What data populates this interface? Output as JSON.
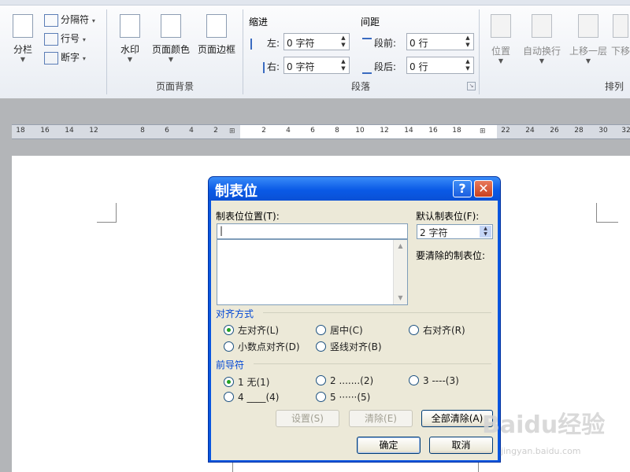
{
  "ribbon": {
    "columns_label": "分栏",
    "breaks_label": "分隔符",
    "line_numbers_label": "行号",
    "hyphenation_label": "断字",
    "watermark_label": "水印",
    "page_color_label": "页面颜色",
    "page_borders_label": "页面边框",
    "page_background_group": "页面背景",
    "indent_header": "缩进",
    "indent_left_label": "左:",
    "indent_left_value": "0 字符",
    "indent_right_label": "右:",
    "indent_right_value": "0 字符",
    "spacing_header": "间距",
    "spacing_before_label": "段前:",
    "spacing_before_value": "0 行",
    "spacing_after_label": "段后:",
    "spacing_after_value": "0 行",
    "paragraph_group": "段落",
    "position_label": "位置",
    "wrap_text_label": "自动换行",
    "bring_forward_label": "上移一层",
    "send_backward_label": "下移",
    "arrange_group": "排列"
  },
  "ruler": {
    "left_numbers": [
      "18",
      "16",
      "14",
      "12",
      "8",
      "6",
      "4",
      "2"
    ],
    "right_numbers": [
      "2",
      "4",
      "6",
      "8",
      "10",
      "12",
      "14",
      "16",
      "18",
      "20",
      "22",
      "24",
      "26",
      "28",
      "30",
      "32"
    ]
  },
  "dialog": {
    "title": "制表位",
    "help_symbol": "?",
    "close_symbol": "✕",
    "tab_stop_position_label": "制表位位置(T):",
    "tab_stop_position_value": "|",
    "default_tab_stops_label": "默认制表位(F):",
    "default_tab_stops_value": "2 字符",
    "tab_stops_to_clear_label": "要清除的制表位:",
    "alignment_title": "对齐方式",
    "alignment_options": [
      "左对齐(L)",
      "居中(C)",
      "右对齐(R)",
      "小数点对齐(D)",
      "竖线对齐(B)"
    ],
    "leader_title": "前导符",
    "leader_options": [
      "1 无(1)",
      "2 .......(2)",
      "3 ----(3)",
      "4 ____(4)",
      "5 ······(5)"
    ],
    "set_button": "设置(S)",
    "clear_button": "清除(E)",
    "clear_all_button": "全部清除(A)",
    "ok_button": "确定",
    "cancel_button": "取消"
  },
  "watermark": {
    "text": "Baidu经验",
    "url": "jingyan.baidu.com"
  }
}
